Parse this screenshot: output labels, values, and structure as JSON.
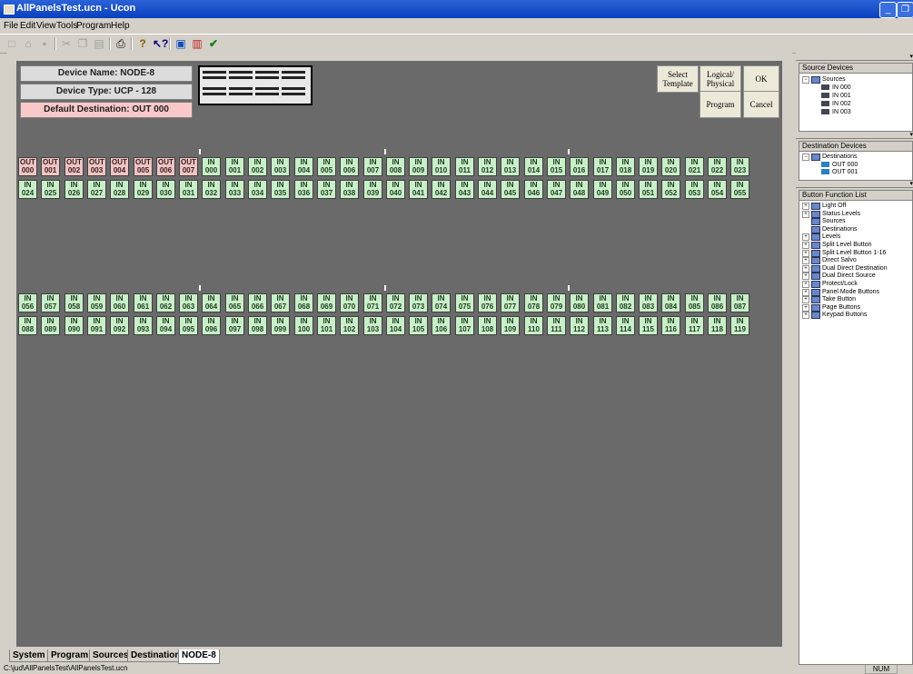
{
  "window": {
    "title": "AllPanelsTest.ucn - Ucon"
  },
  "menu": [
    "File",
    "Edit",
    "View",
    "Tools",
    "Program",
    "Help"
  ],
  "toolbar_icons": [
    "new-icon",
    "open-icon",
    "save-icon",
    "cut-icon",
    "copy-icon",
    "paste-icon",
    "print-icon",
    "help-icon",
    "context-help-icon",
    "device-icon",
    "chart-icon",
    "check-icon"
  ],
  "device": {
    "name": "Device Name: NODE-8",
    "type": "Device Type: UCP - 128",
    "default_dest": "Default Destination: OUT  000"
  },
  "buttons": {
    "select_template": "Select Template",
    "logical_physical": "Logical/ Physical",
    "ok": "OK",
    "program": "Program",
    "cancel": "Cancel"
  },
  "panel_rows": [
    [
      [
        "OUT",
        "000"
      ],
      [
        "OUT",
        "001"
      ],
      [
        "OUT",
        "002"
      ],
      [
        "OUT",
        "003"
      ],
      [
        "OUT",
        "004"
      ],
      [
        "OUT",
        "005"
      ],
      [
        "OUT",
        "006"
      ],
      [
        "OUT",
        "007"
      ],
      [
        "IN",
        "000"
      ],
      [
        "IN",
        "001"
      ],
      [
        "IN",
        "002"
      ],
      [
        "IN",
        "003"
      ],
      [
        "IN",
        "004"
      ],
      [
        "IN",
        "005"
      ],
      [
        "IN",
        "006"
      ],
      [
        "IN",
        "007"
      ],
      [
        "IN",
        "008"
      ],
      [
        "IN",
        "009"
      ],
      [
        "IN",
        "010"
      ],
      [
        "IN",
        "011"
      ],
      [
        "IN",
        "012"
      ],
      [
        "IN",
        "013"
      ],
      [
        "IN",
        "014"
      ],
      [
        "IN",
        "015"
      ],
      [
        "IN",
        "016"
      ],
      [
        "IN",
        "017"
      ],
      [
        "IN",
        "018"
      ],
      [
        "IN",
        "019"
      ],
      [
        "IN",
        "020"
      ],
      [
        "IN",
        "021"
      ],
      [
        "IN",
        "022"
      ],
      [
        "IN",
        "023"
      ]
    ],
    [
      [
        "IN",
        "024"
      ],
      [
        "IN",
        "025"
      ],
      [
        "IN",
        "026"
      ],
      [
        "IN",
        "027"
      ],
      [
        "IN",
        "028"
      ],
      [
        "IN",
        "029"
      ],
      [
        "IN",
        "030"
      ],
      [
        "IN",
        "031"
      ],
      [
        "IN",
        "032"
      ],
      [
        "IN",
        "033"
      ],
      [
        "IN",
        "034"
      ],
      [
        "IN",
        "035"
      ],
      [
        "IN",
        "036"
      ],
      [
        "IN",
        "037"
      ],
      [
        "IN",
        "038"
      ],
      [
        "IN",
        "039"
      ],
      [
        "IN",
        "040"
      ],
      [
        "IN",
        "041"
      ],
      [
        "IN",
        "042"
      ],
      [
        "IN",
        "043"
      ],
      [
        "IN",
        "044"
      ],
      [
        "IN",
        "045"
      ],
      [
        "IN",
        "046"
      ],
      [
        "IN",
        "047"
      ],
      [
        "IN",
        "048"
      ],
      [
        "IN",
        "049"
      ],
      [
        "IN",
        "050"
      ],
      [
        "IN",
        "051"
      ],
      [
        "IN",
        "052"
      ],
      [
        "IN",
        "053"
      ],
      [
        "IN",
        "054"
      ],
      [
        "IN",
        "055"
      ]
    ],
    [
      [
        "IN",
        "056"
      ],
      [
        "IN",
        "057"
      ],
      [
        "IN",
        "058"
      ],
      [
        "IN",
        "059"
      ],
      [
        "IN",
        "060"
      ],
      [
        "IN",
        "061"
      ],
      [
        "IN",
        "062"
      ],
      [
        "IN",
        "063"
      ],
      [
        "IN",
        "064"
      ],
      [
        "IN",
        "065"
      ],
      [
        "IN",
        "066"
      ],
      [
        "IN",
        "067"
      ],
      [
        "IN",
        "068"
      ],
      [
        "IN",
        "069"
      ],
      [
        "IN",
        "070"
      ],
      [
        "IN",
        "071"
      ],
      [
        "IN",
        "072"
      ],
      [
        "IN",
        "073"
      ],
      [
        "IN",
        "074"
      ],
      [
        "IN",
        "075"
      ],
      [
        "IN",
        "076"
      ],
      [
        "IN",
        "077"
      ],
      [
        "IN",
        "078"
      ],
      [
        "IN",
        "079"
      ],
      [
        "IN",
        "080"
      ],
      [
        "IN",
        "081"
      ],
      [
        "IN",
        "082"
      ],
      [
        "IN",
        "083"
      ],
      [
        "IN",
        "084"
      ],
      [
        "IN",
        "085"
      ],
      [
        "IN",
        "086"
      ],
      [
        "IN",
        "087"
      ]
    ],
    [
      [
        "IN",
        "088"
      ],
      [
        "IN",
        "089"
      ],
      [
        "IN",
        "090"
      ],
      [
        "IN",
        "091"
      ],
      [
        "IN",
        "092"
      ],
      [
        "IN",
        "093"
      ],
      [
        "IN",
        "094"
      ],
      [
        "IN",
        "095"
      ],
      [
        "IN",
        "096"
      ],
      [
        "IN",
        "097"
      ],
      [
        "IN",
        "098"
      ],
      [
        "IN",
        "099"
      ],
      [
        "IN",
        "100"
      ],
      [
        "IN",
        "101"
      ],
      [
        "IN",
        "102"
      ],
      [
        "IN",
        "103"
      ],
      [
        "IN",
        "104"
      ],
      [
        "IN",
        "105"
      ],
      [
        "IN",
        "106"
      ],
      [
        "IN",
        "107"
      ],
      [
        "IN",
        "108"
      ],
      [
        "IN",
        "109"
      ],
      [
        "IN",
        "110"
      ],
      [
        "IN",
        "111"
      ],
      [
        "IN",
        "112"
      ],
      [
        "IN",
        "113"
      ],
      [
        "IN",
        "114"
      ],
      [
        "IN",
        "115"
      ],
      [
        "IN",
        "116"
      ],
      [
        "IN",
        "117"
      ],
      [
        "IN",
        "118"
      ],
      [
        "IN",
        "119"
      ]
    ]
  ],
  "tabs": [
    "System",
    "Program",
    "Sources",
    "Destinations",
    "NODE-8"
  ],
  "active_tab": "NODE-8",
  "status": {
    "path": "C:\\jud\\AllPanelsTest\\AllPanelsTest.ucn",
    "num": "NUM"
  },
  "source_devices": {
    "header": "Source Devices",
    "root": "Sources",
    "items": [
      "IN  000",
      "IN  001",
      "IN  002",
      "IN  003"
    ]
  },
  "destination_devices": {
    "header": "Destination Devices",
    "root": "Destinations",
    "items": [
      "OUT  000",
      "OUT  001"
    ]
  },
  "button_functions": {
    "header": "Button Function List",
    "items": [
      "Light Off",
      "Status Levels",
      "Sources",
      "Destinations",
      "Levels",
      "Split Level Button",
      "Split Level Button 1-16",
      "Direct Salvo",
      "Dual Direct Destination",
      "Dual Direct Source",
      "Protect/Lock",
      "Panel Mode Buttons",
      "Take Button",
      "Page Buttons",
      "Keypad Buttons"
    ]
  },
  "colors": {
    "in_button": "#c8f0c8",
    "out_button": "#f0c4c4",
    "canvas": "#6a6a6a"
  }
}
